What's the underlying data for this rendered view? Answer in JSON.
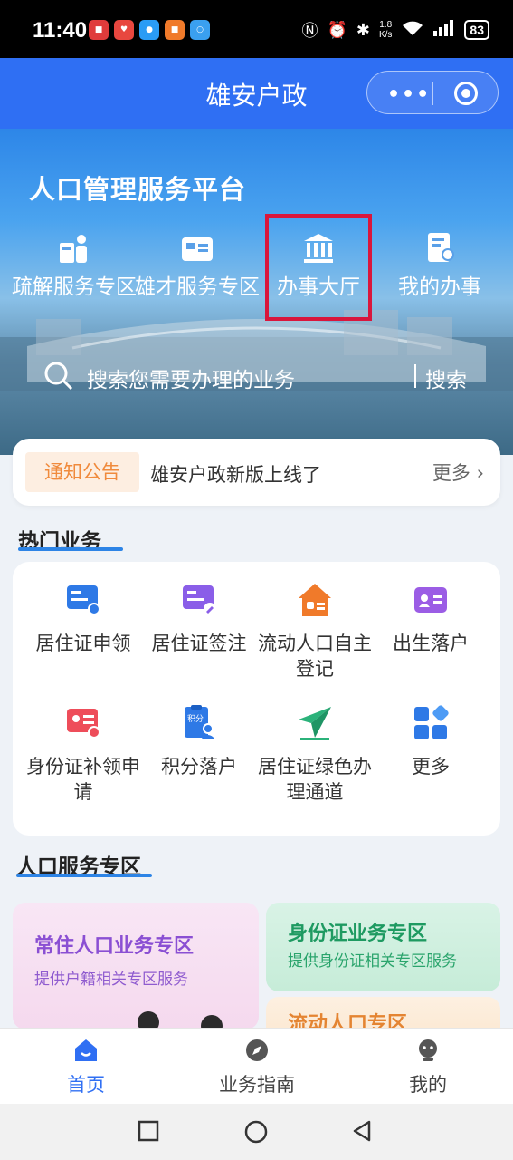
{
  "status_bar": {
    "time": "11:40",
    "net_speed_value": "1.8",
    "net_speed_unit": "K/s",
    "battery": "83"
  },
  "title_bar": {
    "title": "雄安户政",
    "more_dots": "•••"
  },
  "hero": {
    "title": "人口管理服务平台",
    "items": [
      {
        "label": "疏解服务专区",
        "icon": "people-icon"
      },
      {
        "label": "雄才服务专区",
        "icon": "card-icon"
      },
      {
        "label": "办事大厅",
        "icon": "bank-icon"
      },
      {
        "label": "我的办事",
        "icon": "document-user-icon"
      }
    ],
    "search_placeholder": "搜索您需要办理的业务",
    "search_button": "搜索"
  },
  "notice": {
    "tag": "通知公告",
    "text": "雄安户政新版上线了",
    "more": "更多"
  },
  "hot_services": {
    "title": "热门业务",
    "items": [
      {
        "label": "居住证申领",
        "icon": "residence-card-icon"
      },
      {
        "label": "居住证签注",
        "icon": "residence-endorse-icon"
      },
      {
        "label": "流动人口自主登记",
        "icon": "home-register-icon"
      },
      {
        "label": "出生落户",
        "icon": "birth-icon"
      },
      {
        "label": "身份证补领申请",
        "icon": "id-card-icon"
      },
      {
        "label": "积分落户",
        "icon": "points-icon"
      },
      {
        "label": "居住证绿色办理通道",
        "icon": "paper-plane-icon"
      },
      {
        "label": "更多",
        "icon": "grid-icon"
      }
    ]
  },
  "people_zone": {
    "title": "人口服务专区",
    "cards": [
      {
        "title": "常住人口业务专区",
        "subtitle": "提供户籍相关专区服务"
      },
      {
        "title": "身份证业务专区",
        "subtitle": "提供身份证相关专区服务"
      },
      {
        "title": "流动人口专区"
      }
    ]
  },
  "tab_bar": {
    "tabs": [
      {
        "label": "首页",
        "active": true
      },
      {
        "label": "业务指南",
        "active": false
      },
      {
        "label": "我的",
        "active": false
      }
    ]
  },
  "colors": {
    "primary": "#2f6ff3",
    "highlight_box": "#d9163c",
    "notice_tag": "#f08a3c"
  }
}
